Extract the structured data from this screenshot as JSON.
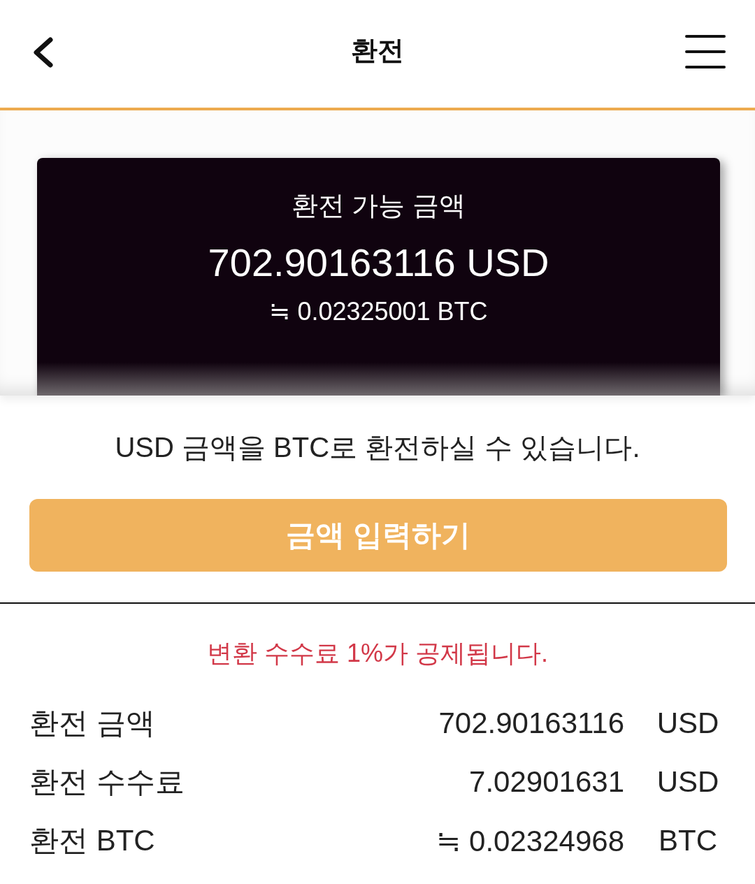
{
  "header": {
    "title": "환전"
  },
  "balance_card": {
    "title": "환전 가능 금액",
    "amount": "702.90163116 USD",
    "btc_equivalent": "≒ 0.02325001 BTC"
  },
  "notice": "USD 금액을 BTC로 환전하실 수 있습니다.",
  "enter_amount_button": {
    "label": "금액 입력하기"
  },
  "fee_notice": "변환 수수료 1%가 공제됩니다.",
  "summary_rows": [
    {
      "label": "환전 금액",
      "value": "702.90163116",
      "unit": "USD"
    },
    {
      "label": "환전 수수료",
      "value": "7.02901631",
      "unit": "USD"
    },
    {
      "label": "환전 BTC",
      "value": "≒ 0.02324968",
      "unit": "BTC"
    }
  ]
}
